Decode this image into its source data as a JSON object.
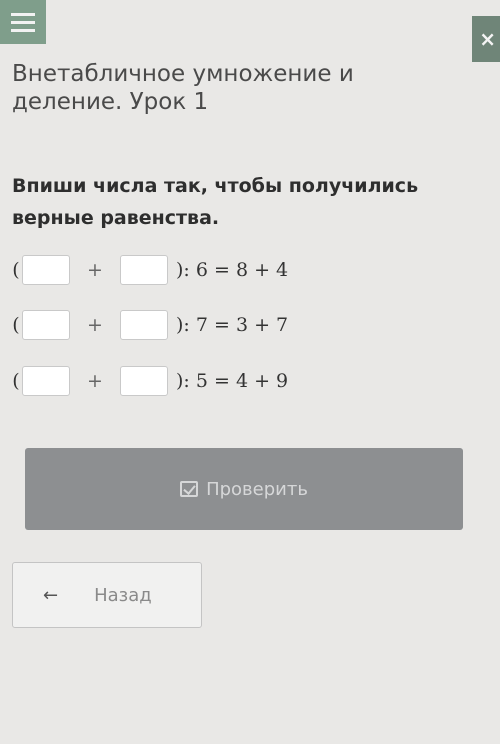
{
  "header": {
    "menu_icon": "hamburger-icon",
    "close_label": "×"
  },
  "lesson": {
    "title": "Внетабличное умножение и деление. Урок 1"
  },
  "task": {
    "instruction": "Впиши числа так, чтобы получились верные равенства.",
    "equations": [
      {
        "open": "(",
        "plus": "+",
        "rest": "): 6 = 8 + 4"
      },
      {
        "open": "(",
        "plus": "+",
        "rest": "): 7 = 3 + 7"
      },
      {
        "open": "(",
        "plus": "+",
        "rest": "): 5 = 4 + 9"
      }
    ]
  },
  "actions": {
    "check_label": "Проверить",
    "back_label": "Назад",
    "back_icon": "←"
  },
  "colors": {
    "menu_bg": "#7f9e8b",
    "check_button_bg": "#8d8f91"
  }
}
